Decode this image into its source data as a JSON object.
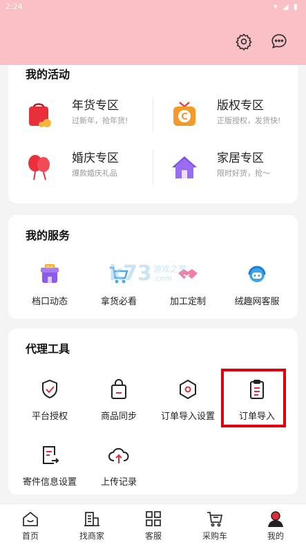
{
  "status_bar": {
    "time": "2:24"
  },
  "activities": {
    "title": "我的活动",
    "items": [
      {
        "title": "年货专区",
        "subtitle": "过新年，抢年货!"
      },
      {
        "title": "版权专区",
        "subtitle": "正版授权，发货快!"
      },
      {
        "title": "婚庆专区",
        "subtitle": "爆款婚庆礼品"
      },
      {
        "title": "家居专区",
        "subtitle": "限时好货，抢～"
      }
    ]
  },
  "services": {
    "title": "我的服务",
    "items": [
      {
        "label": "档口动态",
        "badge": "NEW"
      },
      {
        "label": "拿货必看"
      },
      {
        "label": "加工定制"
      },
      {
        "label": "绒趣网客服"
      }
    ]
  },
  "watermark": {
    "big": "k73",
    "small": "游戏之家",
    "domain": ".com"
  },
  "tools": {
    "title": "代理工具",
    "items": [
      {
        "label": "平台授权"
      },
      {
        "label": "商品同步"
      },
      {
        "label": "订单导入设置"
      },
      {
        "label": "订单导入"
      },
      {
        "label": "寄件信息设置"
      },
      {
        "label": "上传记录"
      }
    ]
  },
  "bottom_nav": {
    "items": [
      {
        "label": "首页"
      },
      {
        "label": "找商家"
      },
      {
        "label": "客服"
      },
      {
        "label": "采购车"
      },
      {
        "label": "我的"
      }
    ]
  },
  "colors": {
    "header": "#fbc0c6",
    "accent": "#e02d3c",
    "highlight": "#e0000b"
  }
}
